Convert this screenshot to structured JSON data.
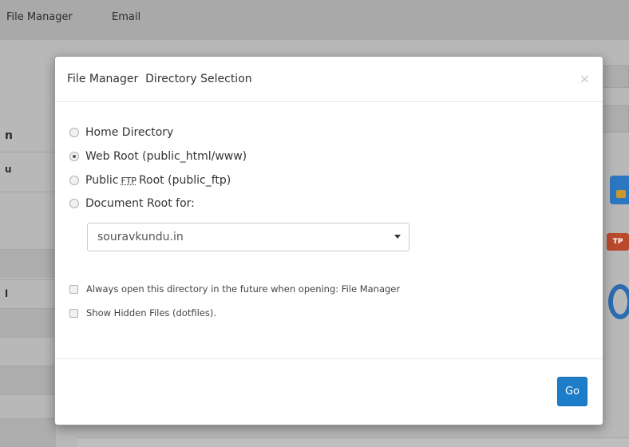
{
  "topbar": {
    "nav": [
      "File Manager",
      "Email"
    ]
  },
  "background": {
    "left_glyphs": [
      "n",
      "u",
      "l"
    ],
    "ftp_icon_label": "TP"
  },
  "modal": {
    "title": "File Manager  Directory Selection",
    "close_label": "×",
    "radio_options": [
      {
        "label": "Home Directory",
        "checked": false
      },
      {
        "label": "Web Root (public_html/www)",
        "checked": true
      },
      {
        "label_before": "Public",
        "label_abbr": "FTP",
        "label_after": "Root (public_ftp)",
        "checked": false
      },
      {
        "label": "Document Root for:",
        "checked": false
      }
    ],
    "domain_select": {
      "value": "souravkundu.in"
    },
    "checkboxes": [
      {
        "label": "Always open this directory in the future when opening: File Manager",
        "checked": false
      },
      {
        "label": "Show Hidden Files (dotfiles).",
        "checked": false
      }
    ],
    "go_label": "Go"
  },
  "colors": {
    "primary_button": "#1e7dc8",
    "overlay": "#b5b5b5"
  }
}
